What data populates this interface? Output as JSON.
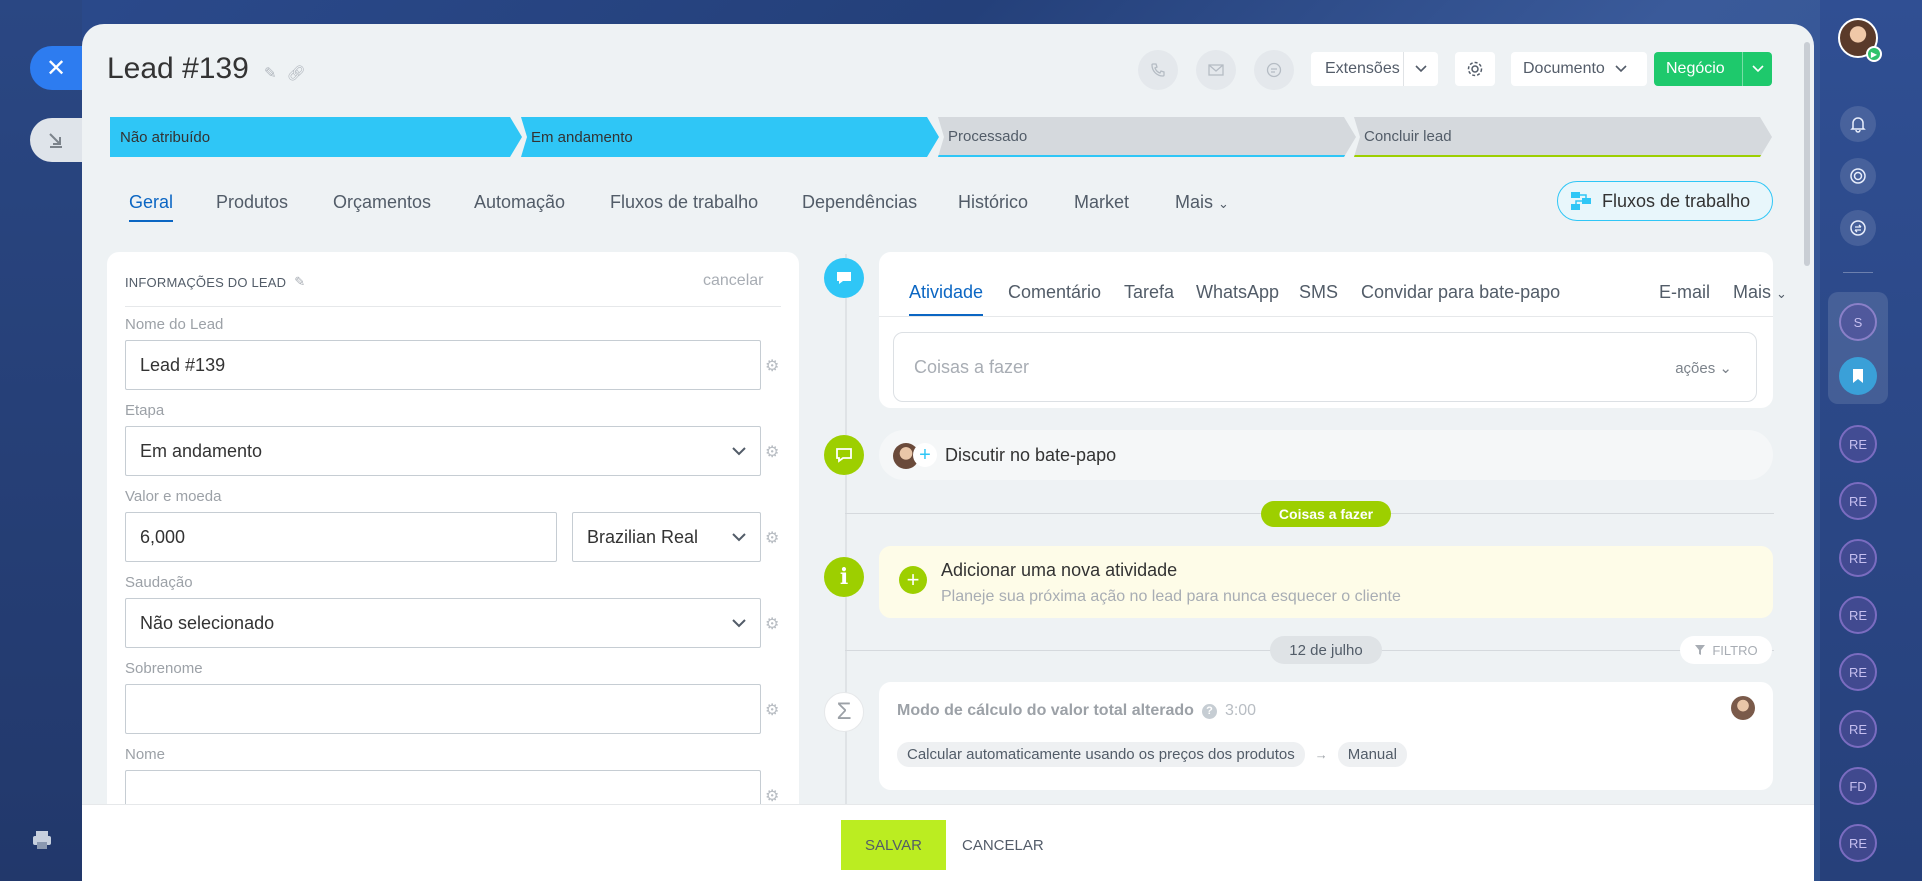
{
  "header": {
    "title": "Lead #139",
    "extensions_label": "Extensões",
    "document_label": "Documento",
    "deal_label": "Negócio"
  },
  "stages": [
    {
      "label": "Não atribuído",
      "state": "active"
    },
    {
      "label": "Em andamento",
      "state": "active"
    },
    {
      "label": "Processado",
      "state": "idle"
    },
    {
      "label": "Concluir lead",
      "state": "final"
    }
  ],
  "tabs": [
    "Geral",
    "Produtos",
    "Orçamentos",
    "Automação",
    "Fluxos de trabalho",
    "Dependências",
    "Histórico",
    "Market",
    "Mais"
  ],
  "workflows_button": "Fluxos de trabalho",
  "lead_info": {
    "title": "INFORMAÇÕES DO LEAD",
    "cancel": "cancelar",
    "fields": {
      "name_label": "Nome do Lead",
      "name_value": "Lead #139",
      "stage_label": "Etapa",
      "stage_value": "Em andamento",
      "amount_label": "Valor e moeda",
      "amount_value": "6,000",
      "currency_value": "Brazilian Real",
      "salutation_label": "Saudação",
      "salutation_value": "Não selecionado",
      "lastname_label": "Sobrenome",
      "lastname_value": "",
      "firstname_label": "Nome"
    }
  },
  "activity": {
    "tabs": [
      "Atividade",
      "Comentário",
      "Tarefa",
      "WhatsApp",
      "SMS",
      "Convidar para bate-papo",
      "E-mail",
      "Mais"
    ],
    "placeholder": "Coisas a fazer",
    "actions": "ações"
  },
  "chat": {
    "label": "Discutir no bate-papo"
  },
  "todo_pill": "Coisas a fazer",
  "add_activity": {
    "title": "Adicionar uma nova atividade",
    "subtitle": "Planeje sua próxima ação no lead para nunca esquecer o cliente"
  },
  "date_pill": "12 de julho",
  "filter_label": "FILTRO",
  "history": {
    "title": "Modo de cálculo do valor total alterado",
    "time": "3:00",
    "from": "Calcular automaticamente usando os preços dos produtos",
    "arrow": "→",
    "to": "Manual"
  },
  "footer": {
    "save": "SALVAR",
    "cancel": "CANCELAR"
  },
  "right_bar": {
    "items": [
      "S",
      "RE",
      "RE",
      "RE",
      "RE",
      "RE",
      "RE",
      "FD",
      "RE"
    ]
  },
  "colors": {
    "accent": "#2fc6f6",
    "green": "#1ec96c",
    "lime": "#9dcf00",
    "link": "#0b66c3"
  }
}
